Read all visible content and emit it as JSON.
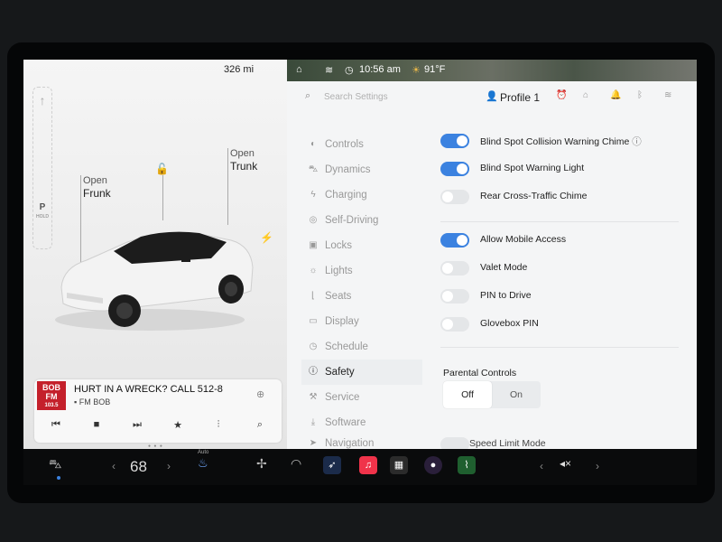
{
  "status_bar": {
    "range": "326 mi",
    "time": "10:56 am",
    "temperature": "91°F"
  },
  "car_panel": {
    "gear": "P",
    "hold": "HOLD",
    "frunk_open": "Open",
    "frunk_label": "Frunk",
    "trunk_open": "Open",
    "trunk_label": "Trunk"
  },
  "media": {
    "logo_line1": "BOB",
    "logo_line2": "FM",
    "logo_line3": "103.5",
    "title": "HURT IN A WRECK? CALL 512-8",
    "station": "FM BOB"
  },
  "settings": {
    "search_placeholder": "Search Settings",
    "profile": "Profile 1",
    "menu": [
      {
        "label": "Controls",
        "icon": "toggle-icon",
        "active": false
      },
      {
        "label": "Dynamics",
        "icon": "car-icon",
        "active": false
      },
      {
        "label": "Charging",
        "icon": "bolt-icon",
        "active": false
      },
      {
        "label": "Self-Driving",
        "icon": "steering-wheel-icon",
        "active": false
      },
      {
        "label": "Locks",
        "icon": "lock-icon",
        "active": false
      },
      {
        "label": "Lights",
        "icon": "sun-icon",
        "active": false
      },
      {
        "label": "Seats",
        "icon": "seat-icon",
        "active": false
      },
      {
        "label": "Display",
        "icon": "display-icon",
        "active": false
      },
      {
        "label": "Schedule",
        "icon": "clock-icon",
        "active": false
      },
      {
        "label": "Safety",
        "icon": "info-circle-icon",
        "active": true
      },
      {
        "label": "Service",
        "icon": "wrench-icon",
        "active": false
      },
      {
        "label": "Software",
        "icon": "download-icon",
        "active": false
      },
      {
        "label": "Navigation",
        "icon": "navigation-icon",
        "active": false
      }
    ],
    "options": [
      {
        "label": "Blind Spot Collision Warning Chime",
        "on": true
      },
      {
        "label": "Blind Spot Warning Light",
        "on": true
      },
      {
        "label": "Rear Cross-Traffic Chime",
        "on": false
      },
      {
        "label": "Allow Mobile Access",
        "on": true
      },
      {
        "label": "Valet Mode",
        "on": false
      },
      {
        "label": "PIN to Drive",
        "on": false
      },
      {
        "label": "Glovebox PIN",
        "on": false
      }
    ],
    "parental_controls": {
      "title": "Parental Controls",
      "off": "Off",
      "on": "On",
      "selected": "Off"
    },
    "cutoff_label": "Speed Limit Mode"
  },
  "dock": {
    "temperature": "68",
    "auto_label": "Auto"
  },
  "colors": {
    "toggle_on": "#3b82e0",
    "toggle_off": "#e4e6e8",
    "media_logo": "#c4202b"
  }
}
